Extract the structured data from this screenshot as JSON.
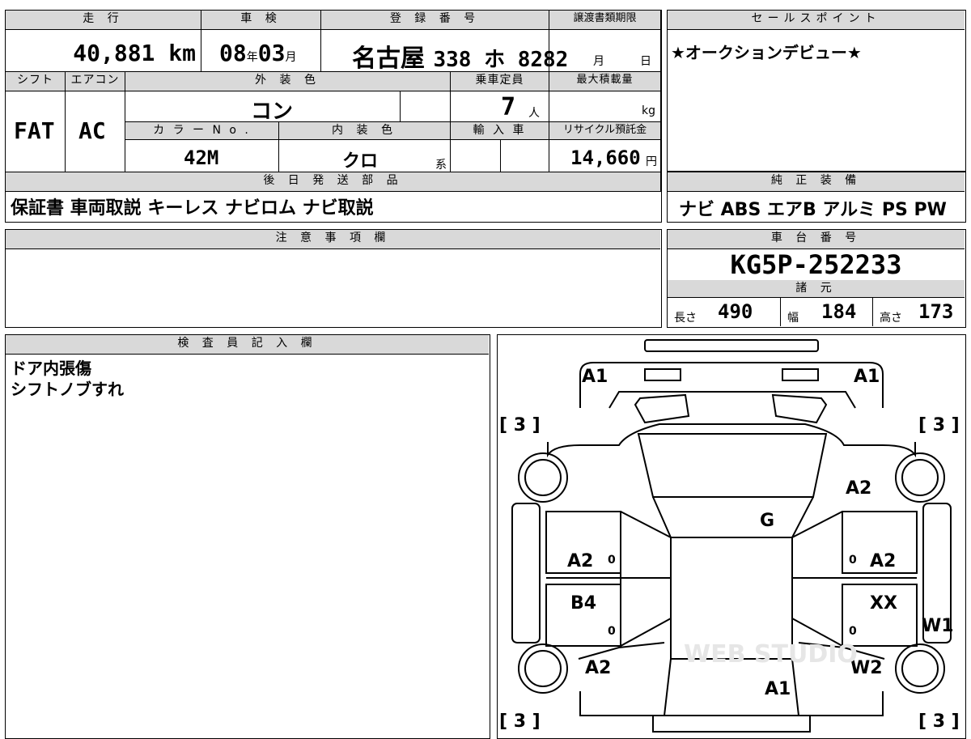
{
  "header": {
    "mileage_label": "走 行",
    "shaken_label": "車 検",
    "reg_label": "登 録 番 号",
    "transfer_label": "譲渡書類期限",
    "sales_label": "セールスポイント"
  },
  "mileage": {
    "value": "40,881",
    "unit": "km"
  },
  "shaken": {
    "year": "08",
    "year_unit": "年",
    "month": "03",
    "month_unit": "月"
  },
  "registration": {
    "region": "名古屋",
    "number": "338 ホ 8282"
  },
  "transfer": {
    "month_unit": "月",
    "day_unit": "日"
  },
  "sales_point": "★オークションデビュー★",
  "row2": {
    "shift_label": "シフト",
    "ac_label": "エアコン",
    "exterior_label": "外 装 色",
    "capacity_label": "乗車定員",
    "load_label": "最大積載量",
    "shift_value": "FAT",
    "ac_value": "AC",
    "exterior_value": "コン",
    "capacity_value": "7",
    "capacity_unit": "人",
    "load_unit": "kg",
    "color_no_label": "カ ラ ー N o .",
    "interior_label": "内 装 色",
    "import_label": "輸 入 車",
    "recycle_label": "リサイクル預託金",
    "color_no_value": "42M",
    "interior_value": "クロ",
    "interior_unit": "系",
    "recycle_value": "14,660",
    "recycle_unit": "円"
  },
  "later_parts": {
    "label": "後 日 発 送 部 品",
    "value": "保証書 車両取説 キーレス ナビロム ナビ取説"
  },
  "equipment": {
    "label": "純 正 装 備",
    "value": "ナビ ABS エアB アルミ PS PW"
  },
  "notes": {
    "label": "注 意 事 項 欄"
  },
  "chassis": {
    "label": "車 台 番 号",
    "value": "KG5P-252233"
  },
  "specs": {
    "label": "諸 元",
    "length_label": "長さ",
    "length_value": "490",
    "width_label": "幅",
    "width_value": "184",
    "height_label": "高さ",
    "height_value": "173"
  },
  "inspector": {
    "label": "検 査 員 記 入 欄",
    "line1": "ドア内張傷",
    "line2": "シフトノブすれ"
  },
  "diagram": {
    "a1_front_left": "A1",
    "a1_front_right": "A1",
    "tire_fl": "[ 3 ]",
    "tire_fr": "[ 3 ]",
    "tire_rl": "[ 3 ]",
    "tire_rr": "[ 3 ]",
    "fender_fr": "A2",
    "glass": "G",
    "door_fl": "A2",
    "door_fr": "A2",
    "door_rl": "B4",
    "door_rr": "XX",
    "zero_1": "0",
    "zero_2": "0",
    "zero_3": "0",
    "zero_4": "0",
    "quarter_rl": "A2",
    "quarter_rr": "W2",
    "side_r": "W1",
    "rear": "A1",
    "watermark": "WEB STUDIO"
  }
}
